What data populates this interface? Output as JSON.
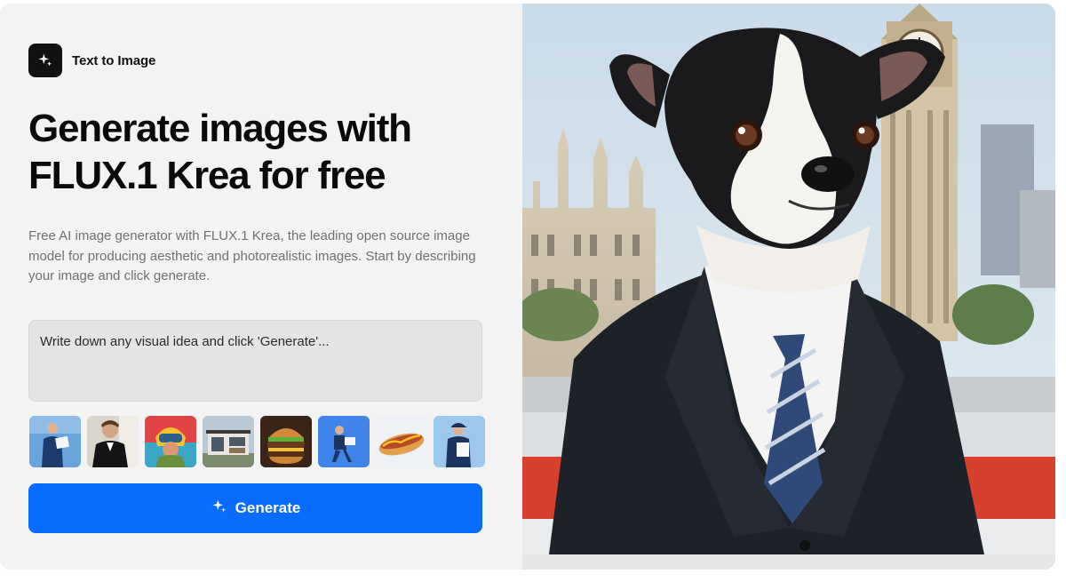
{
  "badge": {
    "label": "Text to Image",
    "icon": "sparkle-icon"
  },
  "headline": {
    "line1": "Generate images with",
    "line2": "FLUX.1 Krea for free"
  },
  "description": "Free AI image generator with FLUX.1 Krea, the leading open source image model for producing aesthetic and photorealistic images. Start by describing your image and click generate.",
  "prompt": {
    "placeholder": "Write down any visual idea and click 'Generate'...",
    "value": ""
  },
  "examples": [
    {
      "name": "man-in-blue-suit-holding-paper"
    },
    {
      "name": "man-in-tuxedo"
    },
    {
      "name": "person-in-colorful-helmet"
    },
    {
      "name": "modern-house"
    },
    {
      "name": "burger"
    },
    {
      "name": "walking-man-blue-background"
    },
    {
      "name": "hot-dog"
    },
    {
      "name": "man-in-cap-holding-paper"
    }
  ],
  "generate_button": {
    "label": "Generate",
    "icon": "sparkle-icon"
  },
  "colors": {
    "accent": "#0a6cff",
    "panel_bg": "#f3f3f4",
    "text_muted": "#707070"
  },
  "hero_image": {
    "subject": "dog-in-business-suit-london-background"
  }
}
